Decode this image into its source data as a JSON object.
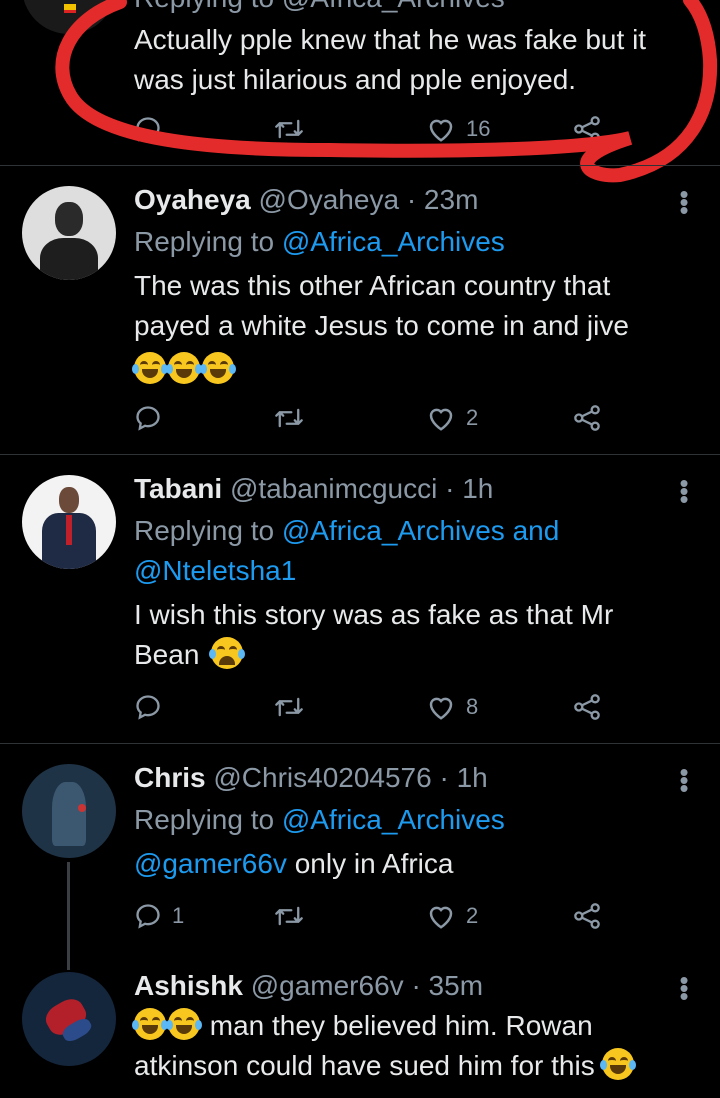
{
  "colors": {
    "background": "#000000",
    "text": "#e7e9ea",
    "muted": "#8b98a5",
    "link": "#1d9bf0",
    "annotation": "#e32b2b"
  },
  "icons": {
    "reply": "reply-icon",
    "retweet": "retweet-icon",
    "like": "heart-icon",
    "share": "share-icon",
    "more": "more-vertical-icon"
  },
  "top_tweet": {
    "replying_partial": "Replying to @Africa_Archives",
    "text": "Actually pple knew that he was fake but it was just hilarious and pple enjoyed.",
    "likes": "16"
  },
  "tweets": [
    {
      "name": "Oyaheya",
      "handle": "@Oyaheya",
      "sep": "·",
      "time": "23m",
      "replying_prefix": "Replying to",
      "replying_to": "@Africa_Archives",
      "replying_and": "",
      "replying_to2": "",
      "text": "The was this other African country that payed a white Jesus to come in and jive",
      "emoji": "😂😂😂",
      "replies": "",
      "likes": "2"
    },
    {
      "name": "Tabani",
      "handle": "@tabanimcgucci",
      "sep": "·",
      "time": "1h",
      "replying_prefix": "Replying to",
      "replying_to": "@Africa_Archives",
      "replying_and": "and",
      "replying_to2": "@Nteletsha1",
      "text": "I wish this story was as fake as that Mr Bean",
      "emoji": "😭",
      "replies": "",
      "likes": "8"
    },
    {
      "name": "Chris",
      "handle": "@Chris40204576",
      "sep": "·",
      "time": "1h",
      "replying_prefix": "Replying to",
      "replying_to": "@Africa_Archives",
      "mention": "@gamer66v",
      "text": "only in Africa",
      "replies": "1",
      "likes": "2"
    },
    {
      "name": "Ashishk",
      "handle": "@gamer66v",
      "sep": "·",
      "time": "35m",
      "emoji_lead": "😂😂",
      "text": "man they believed him. Rowan atkinson could have sued him for this",
      "emoji": "😂"
    }
  ]
}
